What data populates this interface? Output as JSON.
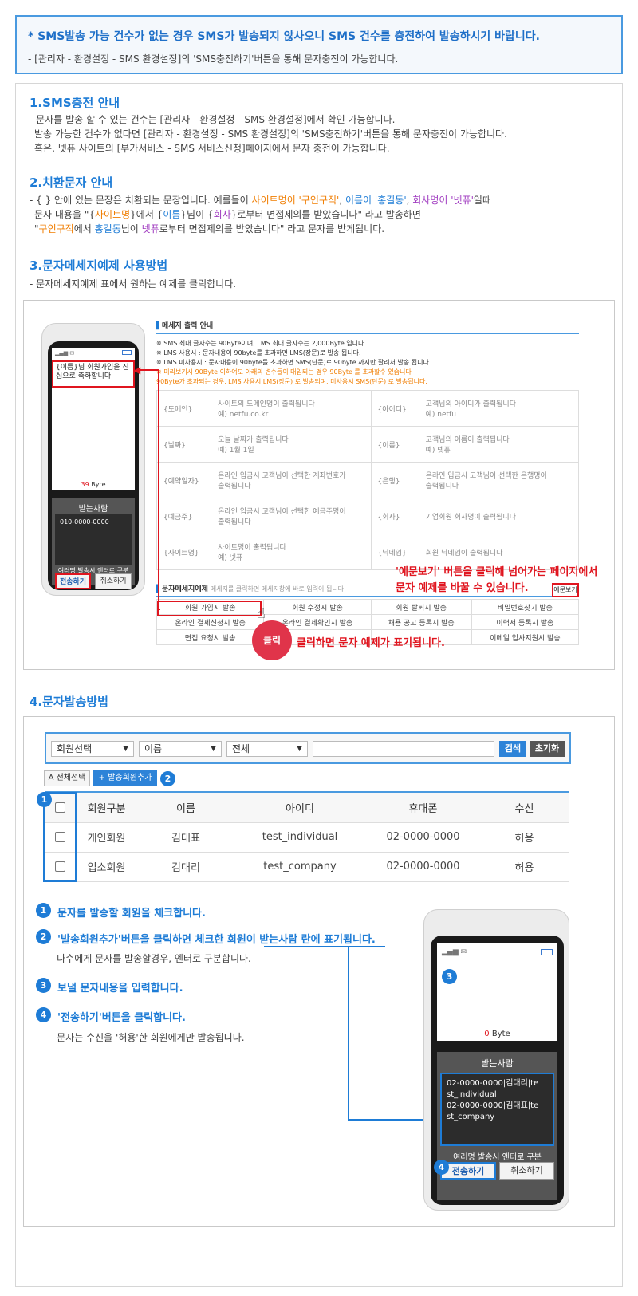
{
  "notice": {
    "line1": "* SMS발송 가능 건수가 없는 경우 SMS가 발송되지 않사오니 SMS 건수를 충전하여 발송하시기 바랍니다.",
    "line2": "- [관리자 - 환경설정 - SMS 환경설정]의 'SMS충전하기'버튼을 통해 문자충전이 가능합니다."
  },
  "section1": {
    "title": "1.SMS충전 안내",
    "lines": [
      "- 문자를 발송 할 수 있는 건수는 [관리자 - 환경설정 - SMS 환경설정]에서 확인 가능합니다.",
      "발송 가능한 건수가 없다면 [관리자 - 환경설정 - SMS 환경설정]의 'SMS충전하기'버튼을 통해 문자충전이 가능합니다.",
      "혹은, 넷퓨 사이트의 [부가서비스 - SMS 서비스신청]페이지에서 문자 충전이 가능합니다."
    ]
  },
  "section2": {
    "title": "2.치환문자 안내",
    "l1a": "- { } 안에 있는 문장은 치환되는 문장입니다. 예를들어 ",
    "l1b": "사이트명이 '구인구직'",
    "l1c": ", ",
    "l1d": "이름이 '홍길동'",
    "l1e": ", ",
    "l1f": "회사명이 '넷퓨'",
    "l1g": "일때",
    "l2a": "문자 내용을 \"{",
    "l2b": "사이트명",
    "l2c": "}에서 {",
    "l2d": "이름",
    "l2e": "}님이 {",
    "l2f": "회사",
    "l2g": "}로부터 면접제의를 받았습니다\" 라고 발송하면",
    "l3a": "\"",
    "l3b": "구인구직",
    "l3c": "에서 ",
    "l3d": "홍길동",
    "l3e": "님이 ",
    "l3f": "넷퓨",
    "l3g": "로부터 면접제의를 받았습니다\" 라고 문자를 받게됩니다."
  },
  "section3": {
    "title": "3.문자메세지예제 사용방법",
    "desc": "- 문자메세지예제 표에서 원하는 예제를 클릭합니다."
  },
  "demo": {
    "phone_msg": "{이름}님 회원가입을 진심으로 축하합니다",
    "byte_count": "39",
    "byte_unit": "Byte",
    "recv_title": "받는사람",
    "recv_value": "010-0000-0000",
    "multi_hint": "여러명 발송시 엔터로 구분",
    "send_btn": "전송하기",
    "cancel_btn": "취소하기",
    "guide_title": "메세지 출력 안내",
    "guide_lines": [
      "※ SMS 최대 글자수는 90Byte이며, LMS 최대 글자수는 2,000Byte 입니다.",
      "※ LMS 사용시 : 문자내용이 90byte를 초과하면 LMS(장문)로 발송 됩니다.",
      "※ LMS 미사용시 : 문자내용이 90byte를 초과하면 SMS(단문)로 90byte 까지만 잘려서 발송 됩니다."
    ],
    "guide_warn": [
      "※ 미리보기시 90Byte 이하여도 아래의 변수들이 대입되는 경우 90Byte 를 초과할수 있습니다",
      "90Byte가 초과되는 경우, LMS 사용시 LMS(장문) 로 발송되며, 미사용시 SMS(단문) 로 발송됩니다."
    ],
    "vars": [
      [
        "{도메인}",
        "사이트의 도메인명이 출력됩니다",
        "예) netfu.co.kr",
        "{아이디}",
        "고객님의 아이디가 출력됩니다",
        "예) netfu"
      ],
      [
        "{날짜}",
        "오늘 날짜가 출력됩니다",
        "예) 1월 1일",
        "{이름}",
        "고객님의 이름이 출력됩니다",
        "예) 넷퓨"
      ],
      [
        "{예약일자}",
        "온라인 입금시 고객님이 선택한 계좌번호가",
        "출력됩니다",
        "{은행}",
        "온라인 입금시 고객님이 선택한 은행명이",
        "출력됩니다"
      ],
      [
        "{예금주}",
        "온라인 입금시 고객님이 선택한 예금주명이",
        "출력됩니다",
        "{회사}",
        "기업회원 회사명이 출력됩니다",
        ""
      ],
      [
        "{사이트명}",
        "사이트명이 출력됩니다",
        "예) 넷퓨",
        "{닉네임}",
        "회원 닉네임이 출력됩니다",
        ""
      ]
    ],
    "example_title": "문자메세지예제",
    "example_hint": "메세지를 클릭하면 메세지창에 바로 입력이 됩니다",
    "example_btn": "예문보기",
    "examples": [
      [
        "회원 가입시 발송",
        "회원 수정시 발송",
        "회원 탈퇴시 발송",
        "비밀번호찾기 발송"
      ],
      [
        "온라인 결제신청시 발송",
        "온라인 결제확인시 발송",
        "채용 공고 등록시 발송",
        "이력서 등록시 발송"
      ],
      [
        "면접 요청시 발송",
        "",
        "",
        "이메일 입사지원시 발송"
      ]
    ],
    "callout1": "'예문보기' 버튼을 클릭해 넘어가는 페이지에서",
    "callout2": "문자 예제를 바꿀 수 있습니다.",
    "click_label": "클릭",
    "click_desc": "클릭하면 문자 예제가 표기됩니다."
  },
  "section4": {
    "title": "4.문자발송방법",
    "select1": "회원선택",
    "select2": "이름",
    "select3": "전체",
    "search_btn": "검색",
    "reset_btn": "초기화",
    "select_all": "A 전체선택",
    "add_btn": "+ 발송회원추가",
    "headers": [
      "회원구분",
      "이름",
      "아이디",
      "휴대폰",
      "수신"
    ],
    "rows": [
      [
        "개인회원",
        "김대표",
        "test_individual",
        "02-0000-0000",
        "허용"
      ],
      [
        "업소회원",
        "김대리",
        "test_company",
        "02-0000-0000",
        "허용"
      ]
    ],
    "steps": [
      {
        "n": "1",
        "text": "문자를 발송할 회원을 체크합니다."
      },
      {
        "n": "2",
        "text": "'발송회원추가'버튼을 클릭하면 체크한 회원이 받는사람 란에 표기됩니다."
      },
      {
        "n": "3",
        "text": "보낼 문자내용을 입력합니다."
      },
      {
        "n": "4",
        "text": "'전송하기'버튼을 클릭합니다."
      }
    ],
    "step2_sub": "- 다수에게 문자를 발송할경우, 엔터로 구분합니다.",
    "step4_sub": "- 문자는 수신을 '허용'한 회원에게만 발송됩니다.",
    "phone_byte": "0",
    "phone_byte_unit": "Byte",
    "recv_title": "받는사람",
    "recv_lines": [
      "02-0000-0000|김대리|te",
      "st_individual",
      "02-0000-0000|김대표|te",
      "st_company"
    ],
    "multi_hint": "여러명 발송시 엔터로 구분",
    "send_btn": "전송하기",
    "cancel_btn": "취소하기"
  }
}
